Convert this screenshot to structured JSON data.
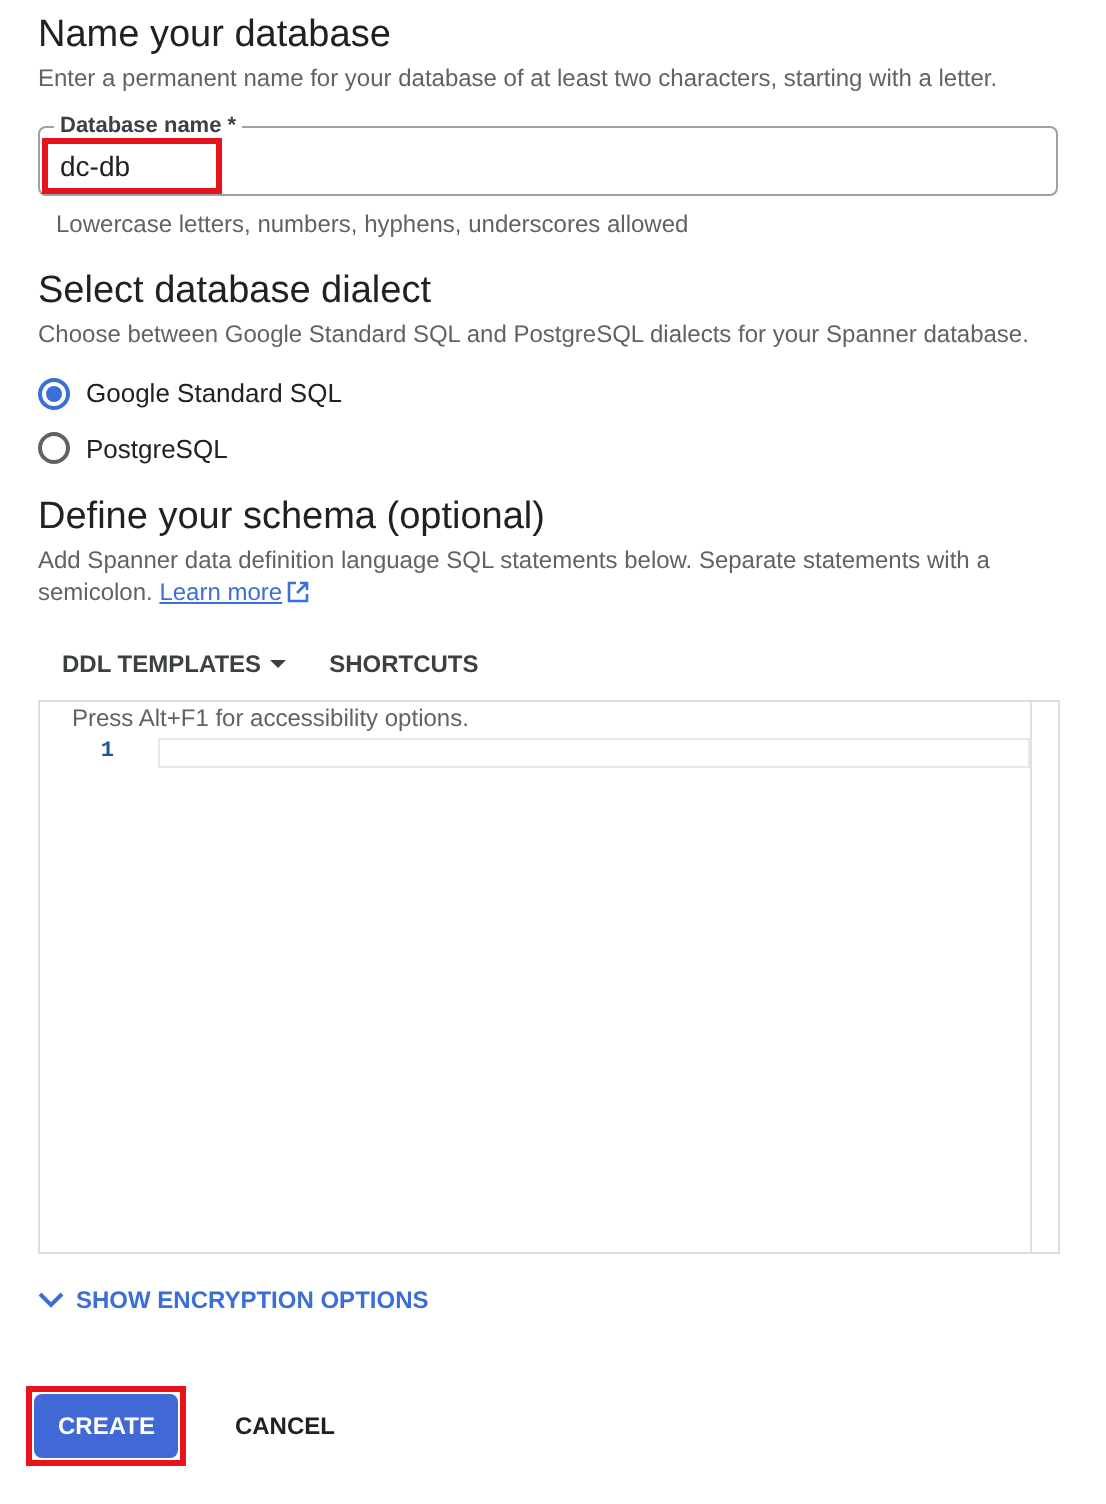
{
  "name_section": {
    "title": "Name your database",
    "description": "Enter a permanent name for your database of at least two characters, starting with a letter.",
    "field": {
      "label": "Database name *",
      "value": "dc-db",
      "hint": "Lowercase letters, numbers, hyphens, underscores allowed",
      "highlighted": true
    }
  },
  "dialect_section": {
    "title": "Select database dialect",
    "description": "Choose between Google Standard SQL and PostgreSQL dialects for your Spanner database.",
    "options": [
      {
        "label": "Google Standard SQL",
        "selected": true
      },
      {
        "label": "PostgreSQL",
        "selected": false
      }
    ]
  },
  "schema_section": {
    "title": "Define your schema (optional)",
    "description": "Add Spanner data definition language SQL statements below. Separate statements with a semicolon.",
    "link": "Learn more",
    "toolbar": [
      "DDL TEMPLATES",
      "SHORTCUTS"
    ],
    "editor": {
      "hint": "Press Alt+F1 for accessibility options.",
      "line_numbers": [
        "1"
      ]
    }
  },
  "encryption_toggle": "SHOW ENCRYPTION OPTIONS",
  "actions": [
    {
      "label": "CREATE",
      "kind": "primary",
      "highlighted": true
    },
    {
      "label": "CANCEL",
      "kind": "text",
      "highlighted": false
    }
  ]
}
